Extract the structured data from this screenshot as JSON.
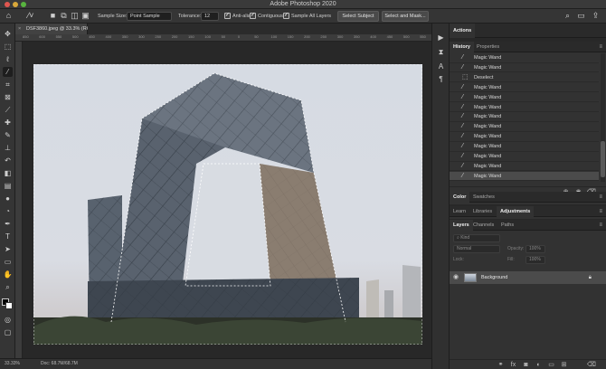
{
  "app": {
    "title": "Adobe Photoshop 2020"
  },
  "options_bar": {
    "sample_size_label": "Sample Size:",
    "sample_size_value": "Point Sample",
    "tolerance_label": "Tolerance:",
    "tolerance_value": "12",
    "anti_alias_label": "Anti-alias",
    "contiguous_label": "Contiguous",
    "sample_all_layers_label": "Sample All Layers",
    "select_subject_label": "Select Subject",
    "select_and_mask_label": "Select and Mask..."
  },
  "document": {
    "tab_label": "DSF3860.jpeg @ 33.3% (RGB/8)",
    "zoom": "33.33%",
    "doc_size": "Doc: 68.7M/68.7M"
  },
  "ruler": {
    "ticks": [
      "850",
      "600",
      "550",
      "500",
      "450",
      "400",
      "350",
      "300",
      "250",
      "200",
      "150",
      "100",
      "50",
      "0",
      "50",
      "100",
      "150",
      "200",
      "250",
      "300",
      "350",
      "400",
      "450",
      "500",
      "550"
    ]
  },
  "panels": {
    "actions_tab": "Actions",
    "history_tab": "History",
    "properties_tab": "Properties",
    "history_items": [
      {
        "label": "Magic Wand",
        "icon": "magic-wand-icon",
        "selected": false
      },
      {
        "label": "Magic Wand",
        "icon": "magic-wand-icon",
        "selected": false
      },
      {
        "label": "Deselect",
        "icon": "deselect-icon",
        "selected": false
      },
      {
        "label": "Magic Wand",
        "icon": "magic-wand-icon",
        "selected": false
      },
      {
        "label": "Magic Wand",
        "icon": "magic-wand-icon",
        "selected": false
      },
      {
        "label": "Magic Wand",
        "icon": "magic-wand-icon",
        "selected": false
      },
      {
        "label": "Magic Wand",
        "icon": "magic-wand-icon",
        "selected": false
      },
      {
        "label": "Magic Wand",
        "icon": "magic-wand-icon",
        "selected": false
      },
      {
        "label": "Magic Wand",
        "icon": "magic-wand-icon",
        "selected": false
      },
      {
        "label": "Magic Wand",
        "icon": "magic-wand-icon",
        "selected": false
      },
      {
        "label": "Magic Wand",
        "icon": "magic-wand-icon",
        "selected": false
      },
      {
        "label": "Magic Wand",
        "icon": "magic-wand-icon",
        "selected": false
      },
      {
        "label": "Magic Wand",
        "icon": "magic-wand-icon",
        "selected": true
      }
    ],
    "color_tab": "Color",
    "swatches_tab": "Swatches",
    "learn_tab": "Learn",
    "libraries_tab": "Libraries",
    "adjustments_tab": "Adjustments",
    "layers_tab": "Layers",
    "channels_tab": "Channels",
    "paths_tab": "Paths",
    "layers": {
      "filter_placeholder": "Kind",
      "blend_mode": "Normal",
      "opacity_label": "Opacity:",
      "opacity_value": "100%",
      "lock_label": "Lock:",
      "fill_label": "Fill:",
      "fill_value": "100%",
      "items": [
        {
          "name": "Background",
          "visible": true,
          "locked": true
        }
      ]
    }
  },
  "colors": {
    "panel_bg": "#323232",
    "app_bg": "#282828",
    "selected_row": "#4b4b4b",
    "sky": "#d3d9e2",
    "building": "#4c5561"
  }
}
